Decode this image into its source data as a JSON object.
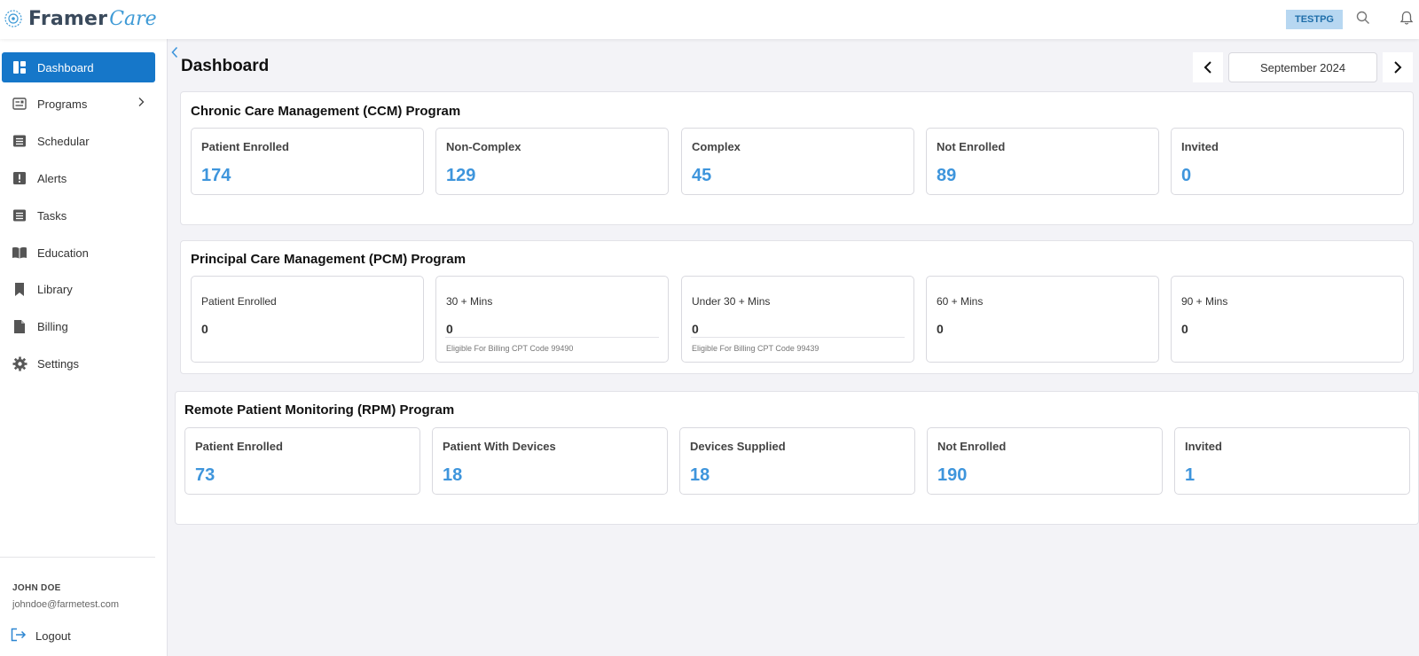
{
  "brand": {
    "word1": "Framer",
    "word2": "Care"
  },
  "header": {
    "org_badge": "TESTPG",
    "search_icon": "search-icon",
    "bell_icon": "bell-icon"
  },
  "sidebar": {
    "items": [
      {
        "label": "Dashboard",
        "icon": "dashboard-icon",
        "active": true
      },
      {
        "label": "Programs",
        "icon": "programs-icon",
        "has_submenu": true
      },
      {
        "label": "Schedular",
        "icon": "schedular-icon"
      },
      {
        "label": "Alerts",
        "icon": "alert-icon"
      },
      {
        "label": "Tasks",
        "icon": "tasks-icon"
      },
      {
        "label": "Education",
        "icon": "book-icon"
      },
      {
        "label": "Library",
        "icon": "bookmark-icon"
      },
      {
        "label": "Billing",
        "icon": "document-icon"
      },
      {
        "label": "Settings",
        "icon": "gear-icon"
      }
    ],
    "user": {
      "name": "JOHN DOE",
      "email": "johndoe@farmetest.com"
    },
    "logout_label": "Logout"
  },
  "page": {
    "title": "Dashboard",
    "month": "September 2024"
  },
  "ccm": {
    "title": "Chronic Care Management (CCM) Program",
    "cards": [
      {
        "label": "Patient Enrolled",
        "value": "174"
      },
      {
        "label": "Non-Complex",
        "value": "129"
      },
      {
        "label": "Complex",
        "value": "45"
      },
      {
        "label": "Not Enrolled",
        "value": "89"
      },
      {
        "label": "Invited",
        "value": "0"
      }
    ]
  },
  "pcm": {
    "title": "Principal Care Management (PCM) Program",
    "cards": [
      {
        "label": "Patient Enrolled",
        "value": "0",
        "note": ""
      },
      {
        "label": "30 + Mins",
        "value": "0",
        "note": "Eligible For Billing CPT Code 99490"
      },
      {
        "label": "Under 30 + Mins",
        "value": "0",
        "note": "Eligible For Billing CPT Code 99439"
      },
      {
        "label": "60 + Mins",
        "value": "0",
        "note": ""
      },
      {
        "label": "90 + Mins",
        "value": "0",
        "note": ""
      }
    ]
  },
  "rpm": {
    "title": "Remote Patient Monitoring (RPM) Program",
    "cards": [
      {
        "label": "Patient Enrolled",
        "value": "73"
      },
      {
        "label": "Patient With Devices",
        "value": "18"
      },
      {
        "label": "Devices Supplied",
        "value": "18"
      },
      {
        "label": "Not Enrolled",
        "value": "190"
      },
      {
        "label": "Invited",
        "value": "1"
      }
    ]
  },
  "colors": {
    "primary": "#1677c9",
    "value_blue": "#3e95dc",
    "badge_bg": "#b7d7f1",
    "page_bg": "#f3f3f7"
  }
}
